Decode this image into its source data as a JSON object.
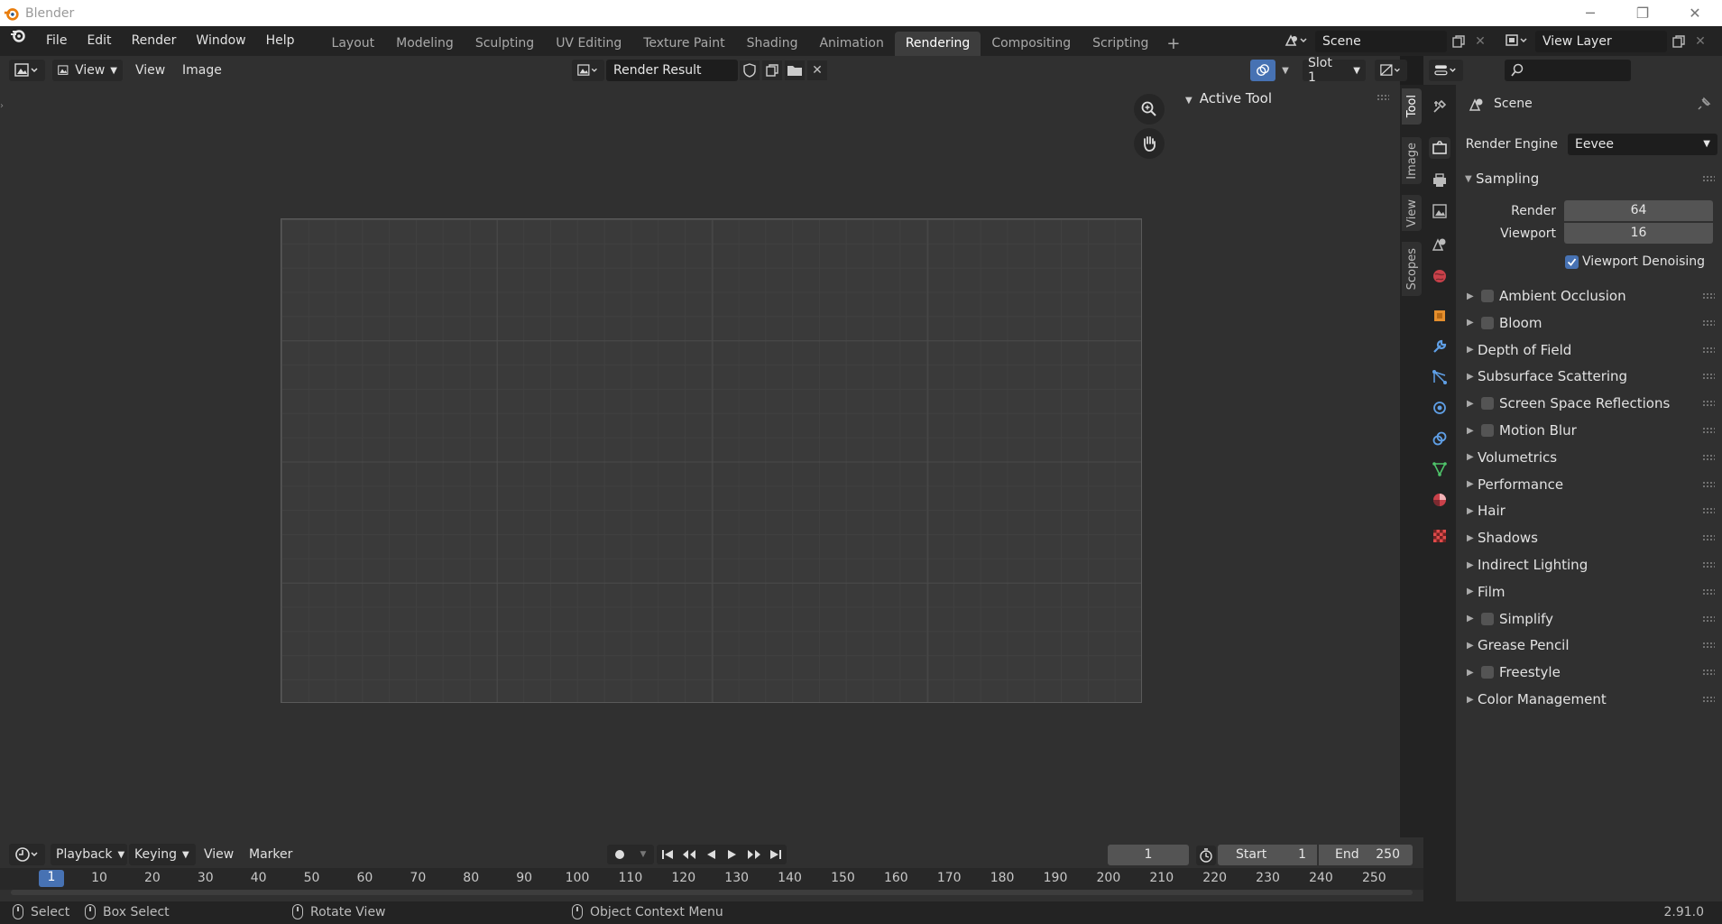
{
  "window": {
    "title": "Blender"
  },
  "menu": [
    "File",
    "Edit",
    "Render",
    "Window",
    "Help"
  ],
  "workspaces": [
    {
      "label": "Layout",
      "active": false
    },
    {
      "label": "Modeling",
      "active": false
    },
    {
      "label": "Sculpting",
      "active": false
    },
    {
      "label": "UV Editing",
      "active": false
    },
    {
      "label": "Texture Paint",
      "active": false
    },
    {
      "label": "Shading",
      "active": false
    },
    {
      "label": "Animation",
      "active": false
    },
    {
      "label": "Rendering",
      "active": true
    },
    {
      "label": "Compositing",
      "active": false
    },
    {
      "label": "Scripting",
      "active": false
    }
  ],
  "scene": {
    "name": "Scene"
  },
  "view_layer": {
    "name": "View Layer"
  },
  "image_editor": {
    "view_label": "View",
    "menu": [
      "View",
      "Image"
    ],
    "image_name": "Render Result",
    "slot": "Slot 1",
    "npanel_title": "Active Tool",
    "side_tabs": [
      "Tool",
      "Image",
      "View",
      "Scopes"
    ]
  },
  "properties": {
    "context": "Scene",
    "render_engine_label": "Render Engine",
    "render_engine": "Eevee",
    "sampling_title": "Sampling",
    "render_label": "Render",
    "render_samples": "64",
    "viewport_label": "Viewport",
    "viewport_samples": "16",
    "viewport_denoising": "Viewport Denoising",
    "panels": [
      {
        "label": "Ambient Occlusion",
        "checkbox": true
      },
      {
        "label": "Bloom",
        "checkbox": true
      },
      {
        "label": "Depth of Field",
        "checkbox": false
      },
      {
        "label": "Subsurface Scattering",
        "checkbox": false
      },
      {
        "label": "Screen Space Reflections",
        "checkbox": true
      },
      {
        "label": "Motion Blur",
        "checkbox": true
      },
      {
        "label": "Volumetrics",
        "checkbox": false
      },
      {
        "label": "Performance",
        "checkbox": false
      },
      {
        "label": "Hair",
        "checkbox": false
      },
      {
        "label": "Shadows",
        "checkbox": false
      },
      {
        "label": "Indirect Lighting",
        "checkbox": false
      },
      {
        "label": "Film",
        "checkbox": false
      },
      {
        "label": "Simplify",
        "checkbox": true
      },
      {
        "label": "Grease Pencil",
        "checkbox": false
      },
      {
        "label": "Freestyle",
        "checkbox": true
      },
      {
        "label": "Color Management",
        "checkbox": false
      }
    ]
  },
  "timeline": {
    "menu": [
      "Playback",
      "Keying",
      "View",
      "Marker"
    ],
    "current_frame": "1",
    "start_label": "Start",
    "start": "1",
    "end_label": "End",
    "end": "250",
    "ruler": [
      "1",
      "10",
      "20",
      "30",
      "40",
      "50",
      "60",
      "70",
      "80",
      "90",
      "100",
      "110",
      "120",
      "130",
      "140",
      "150",
      "160",
      "170",
      "180",
      "190",
      "200",
      "210",
      "220",
      "230",
      "240",
      "250"
    ]
  },
  "statusbar": {
    "select": "Select",
    "box_select": "Box Select",
    "rotate_view": "Rotate View",
    "context_menu": "Object Context Menu",
    "version": "2.91.0"
  }
}
